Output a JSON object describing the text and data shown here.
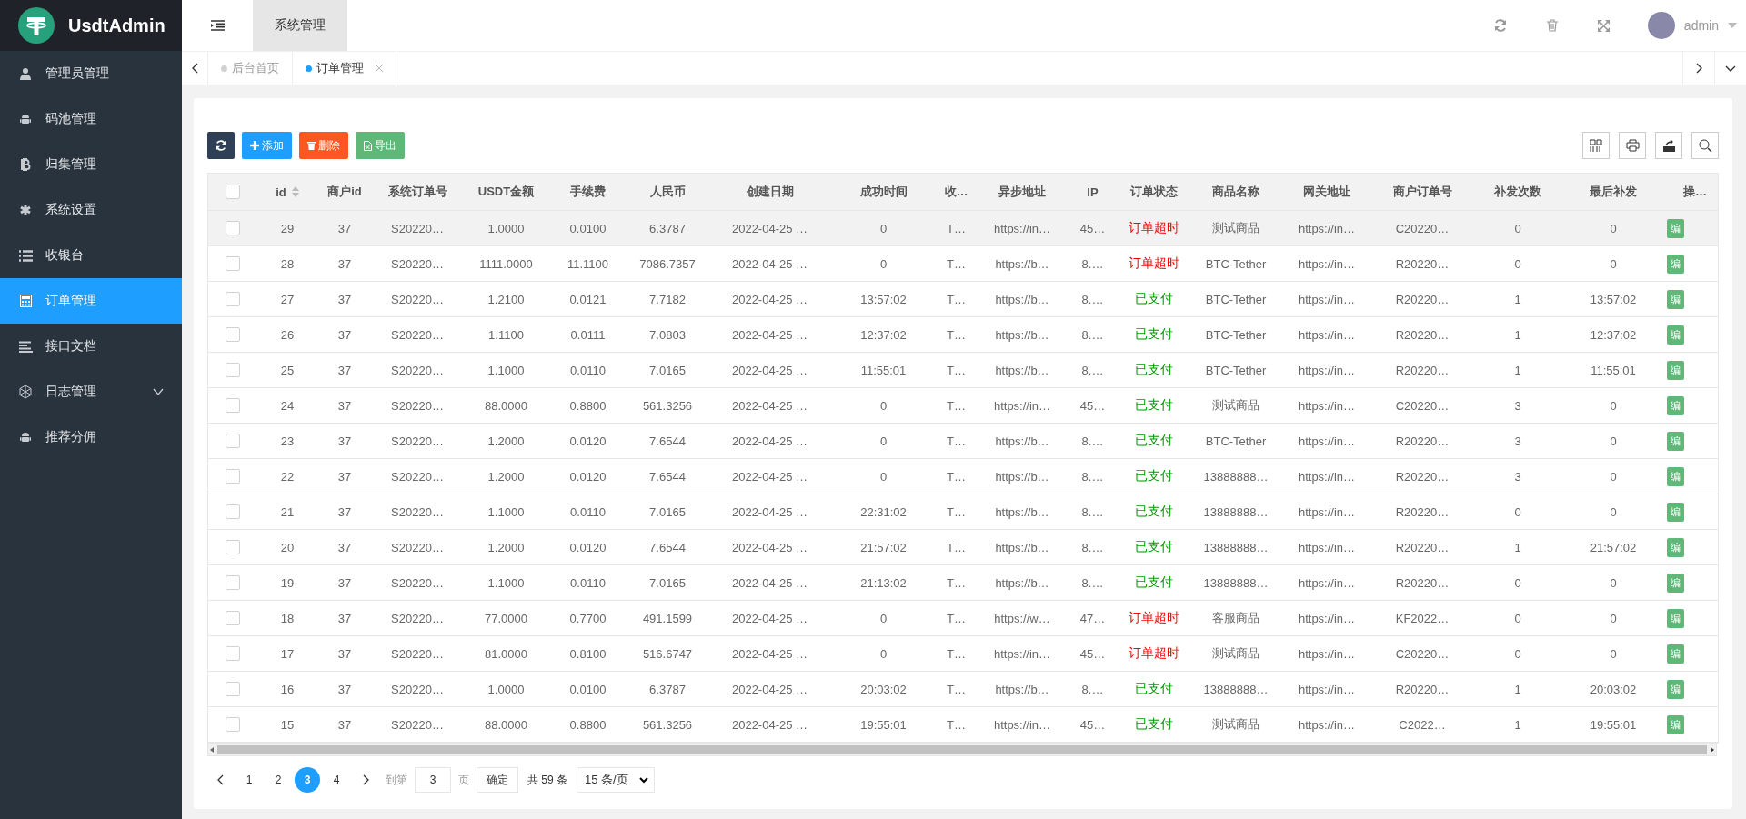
{
  "brand": {
    "name": "UsdtAdmin"
  },
  "header": {
    "tabs": [
      {
        "label": "系统管理",
        "selected": true
      }
    ],
    "user": "admin"
  },
  "sidebar": {
    "items": [
      {
        "label": "管理员管理",
        "selected": false
      },
      {
        "label": "码池管理",
        "selected": false
      },
      {
        "label": "归集管理",
        "selected": false
      },
      {
        "label": "系统设置",
        "selected": false
      },
      {
        "label": "收银台",
        "selected": false
      },
      {
        "label": "订单管理",
        "selected": true
      },
      {
        "label": "接口文档",
        "selected": false
      },
      {
        "label": "日志管理",
        "selected": false,
        "expanded": false
      },
      {
        "label": "推荐分佣",
        "selected": false
      }
    ]
  },
  "page_tabs": [
    {
      "label": "后台首页",
      "selected": false
    },
    {
      "label": "订单管理",
      "selected": true
    }
  ],
  "toolbar": {
    "buttons": [
      {
        "label": "添加",
        "kind": "add"
      },
      {
        "label": "删除",
        "kind": "delete"
      },
      {
        "label": "导出",
        "kind": "export"
      }
    ]
  },
  "table": {
    "all_checked": false,
    "columns": [
      {
        "label": "id",
        "kind": "sortable"
      },
      {
        "label": "商户id",
        "kind": "plain"
      },
      {
        "label": "系统订单号",
        "kind": "plain"
      },
      {
        "label": "USDT金额",
        "kind": "plain"
      },
      {
        "label": "手续费",
        "kind": "plain"
      },
      {
        "label": "人民币",
        "kind": "plain"
      },
      {
        "label": "创建日期",
        "kind": "plain"
      },
      {
        "label": "成功时间",
        "kind": "plain"
      },
      {
        "label": "收…",
        "kind": "plain"
      },
      {
        "label": "异步地址",
        "kind": "plain"
      },
      {
        "label": "IP",
        "kind": "plain"
      },
      {
        "label": "订单状态",
        "kind": "status"
      },
      {
        "label": "商品名称",
        "kind": "plain"
      },
      {
        "label": "网关地址",
        "kind": "plain"
      },
      {
        "label": "商户订单号",
        "kind": "plain"
      },
      {
        "label": "补发次数",
        "kind": "plain"
      },
      {
        "label": "最后补发",
        "kind": "plain"
      },
      {
        "label": "操…",
        "kind": "action"
      }
    ],
    "rows": [
      {
        "checked": false,
        "highlighted": true,
        "color": "#ff0000",
        "action": "编",
        "cells": [
          "29",
          "37",
          "S20220…",
          "1.0000",
          "0.0100",
          "6.3787",
          "2022-04-25 …",
          "0",
          "T…",
          "https://in…",
          "45…",
          "订单超时",
          "测试商品",
          "https://in…",
          "C20220…",
          "0",
          "0"
        ]
      },
      {
        "checked": false,
        "highlighted": false,
        "color": "#ff0000",
        "action": "编",
        "cells": [
          "28",
          "37",
          "S20220…",
          "1111.0000",
          "11.1100",
          "7086.7357",
          "2022-04-25 …",
          "0",
          "T…",
          "https://b…",
          "8.…",
          "订单超时",
          "BTC-Tether",
          "https://in…",
          "R20220…",
          "0",
          "0"
        ]
      },
      {
        "checked": false,
        "highlighted": false,
        "color": "#009900",
        "action": "编",
        "cells": [
          "27",
          "37",
          "S20220…",
          "1.2100",
          "0.0121",
          "7.7182",
          "2022-04-25 …",
          "13:57:02",
          "T…",
          "https://b…",
          "8.…",
          "已支付",
          "BTC-Tether",
          "https://in…",
          "R20220…",
          "1",
          "13:57:02"
        ]
      },
      {
        "checked": false,
        "highlighted": false,
        "color": "#009900",
        "action": "编",
        "cells": [
          "26",
          "37",
          "S20220…",
          "1.1100",
          "0.0111",
          "7.0803",
          "2022-04-25 …",
          "12:37:02",
          "T…",
          "https://b…",
          "8.…",
          "已支付",
          "BTC-Tether",
          "https://in…",
          "R20220…",
          "1",
          "12:37:02"
        ]
      },
      {
        "checked": false,
        "highlighted": false,
        "color": "#009900",
        "action": "编",
        "cells": [
          "25",
          "37",
          "S20220…",
          "1.1000",
          "0.0110",
          "7.0165",
          "2022-04-25 …",
          "11:55:01",
          "T…",
          "https://b…",
          "8.…",
          "已支付",
          "BTC-Tether",
          "https://in…",
          "R20220…",
          "1",
          "11:55:01"
        ]
      },
      {
        "checked": false,
        "highlighted": false,
        "color": "#009900",
        "action": "编",
        "cells": [
          "24",
          "37",
          "S20220…",
          "88.0000",
          "0.8800",
          "561.3256",
          "2022-04-25 …",
          "0",
          "T…",
          "https://in…",
          "45…",
          "已支付",
          "测试商品",
          "https://in…",
          "C20220…",
          "3",
          "0"
        ]
      },
      {
        "checked": false,
        "highlighted": false,
        "color": "#009900",
        "action": "编",
        "cells": [
          "23",
          "37",
          "S20220…",
          "1.2000",
          "0.0120",
          "7.6544",
          "2022-04-25 …",
          "0",
          "T…",
          "https://b…",
          "8.…",
          "已支付",
          "BTC-Tether",
          "https://in…",
          "R20220…",
          "3",
          "0"
        ]
      },
      {
        "checked": false,
        "highlighted": false,
        "color": "#009900",
        "action": "编",
        "cells": [
          "22",
          "37",
          "S20220…",
          "1.2000",
          "0.0120",
          "7.6544",
          "2022-04-25 …",
          "0",
          "T…",
          "https://b…",
          "8.…",
          "已支付",
          "13888888…",
          "https://in…",
          "R20220…",
          "3",
          "0"
        ]
      },
      {
        "checked": false,
        "highlighted": false,
        "color": "#009900",
        "action": "编",
        "cells": [
          "21",
          "37",
          "S20220…",
          "1.1000",
          "0.0110",
          "7.0165",
          "2022-04-25 …",
          "22:31:02",
          "T…",
          "https://b…",
          "8.…",
          "已支付",
          "13888888…",
          "https://in…",
          "R20220…",
          "0",
          "0"
        ]
      },
      {
        "checked": false,
        "highlighted": false,
        "color": "#009900",
        "action": "编",
        "cells": [
          "20",
          "37",
          "S20220…",
          "1.2000",
          "0.0120",
          "7.6544",
          "2022-04-25 …",
          "21:57:02",
          "T…",
          "https://b…",
          "8.…",
          "已支付",
          "13888888…",
          "https://in…",
          "R20220…",
          "1",
          "21:57:02"
        ]
      },
      {
        "checked": false,
        "highlighted": false,
        "color": "#009900",
        "action": "编",
        "cells": [
          "19",
          "37",
          "S20220…",
          "1.1000",
          "0.0110",
          "7.0165",
          "2022-04-25 …",
          "21:13:02",
          "T…",
          "https://b…",
          "8.…",
          "已支付",
          "13888888…",
          "https://in…",
          "R20220…",
          "0",
          "0"
        ]
      },
      {
        "checked": false,
        "highlighted": false,
        "color": "#ff0000",
        "action": "编",
        "cells": [
          "18",
          "37",
          "S20220…",
          "77.0000",
          "0.7700",
          "491.1599",
          "2022-04-25 …",
          "0",
          "T…",
          "https://w…",
          "47…",
          "订单超时",
          "客服商品",
          "https://in…",
          "KF2022…",
          "0",
          "0"
        ]
      },
      {
        "checked": false,
        "highlighted": false,
        "color": "#ff0000",
        "action": "编",
        "cells": [
          "17",
          "37",
          "S20220…",
          "81.0000",
          "0.8100",
          "516.6747",
          "2022-04-25 …",
          "0",
          "T…",
          "https://in…",
          "45…",
          "订单超时",
          "测试商品",
          "https://in…",
          "C20220…",
          "0",
          "0"
        ]
      },
      {
        "checked": false,
        "highlighted": false,
        "color": "#009900",
        "action": "编",
        "cells": [
          "16",
          "37",
          "S20220…",
          "1.0000",
          "0.0100",
          "6.3787",
          "2022-04-25 …",
          "20:03:02",
          "T…",
          "https://b…",
          "8.…",
          "已支付",
          "13888888…",
          "https://in…",
          "R20220…",
          "1",
          "20:03:02"
        ]
      },
      {
        "checked": false,
        "highlighted": false,
        "color": "#009900",
        "action": "编",
        "cells": [
          "15",
          "37",
          "S20220…",
          "88.0000",
          "0.8800",
          "561.3256",
          "2022-04-25 …",
          "19:55:01",
          "T…",
          "https://in…",
          "45…",
          "已支付",
          "测试商品",
          "https://in…",
          "C2022…",
          "1",
          "19:55:01"
        ]
      }
    ]
  },
  "pagination": {
    "pages": [
      {
        "label": "1",
        "selected": false
      },
      {
        "label": "2",
        "selected": false
      },
      {
        "label": "3",
        "selected": true
      },
      {
        "label": "4",
        "selected": false
      }
    ],
    "goto_label": "到第",
    "goto_value": "3",
    "page_unit": "页",
    "confirm": "确定",
    "total": "共 59 条",
    "page_size": "15 条/页"
  }
}
